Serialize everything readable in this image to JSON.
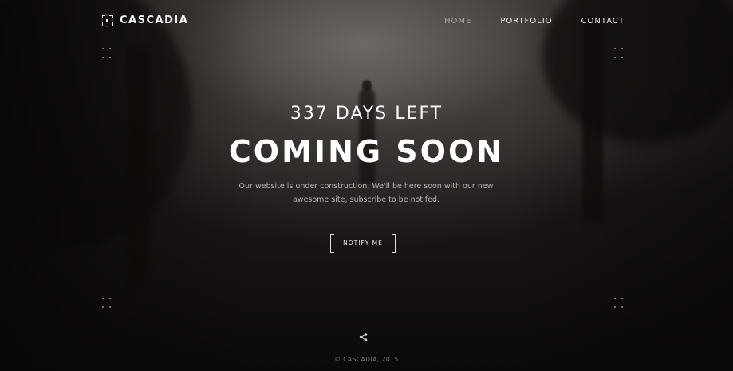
{
  "header": {
    "brand": "CASCADIA",
    "nav": [
      {
        "label": "HOME",
        "active": true
      },
      {
        "label": "PORTFOLIO",
        "active": false
      },
      {
        "label": "CONTACT",
        "active": false
      }
    ]
  },
  "hero": {
    "days_left": "337 DAYS LEFT",
    "title": "COMING SOON",
    "description_line1": "Our website is under construction. We'll be here soon with our new",
    "description_line2": "awesome site, subscribe to be notifed.",
    "notify_button": "NOTIFY ME"
  },
  "footer": {
    "share_icon": "share-icon",
    "copyright": "© CASCADIA, 2015"
  },
  "colors": {
    "background": "#0d0b0a",
    "text": "#ffffff",
    "muted_text": "#b9b5b3",
    "nav_active": "#a9a5a3"
  }
}
